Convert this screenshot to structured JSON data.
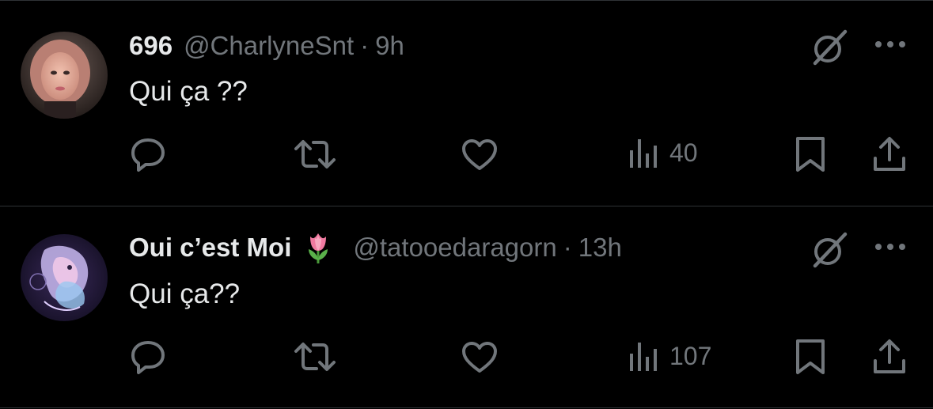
{
  "colors": {
    "background": "#000000",
    "primary_text": "#e7e9ea",
    "secondary_text": "#71767b",
    "divider": "#2f3336"
  },
  "tweets": [
    {
      "display_name": "696",
      "handle": "@CharlyneSnt",
      "separator": "·",
      "time": "9h",
      "text": "Qui ça ??",
      "views": "40",
      "avatar_icon": "photo-avatar",
      "name_emoji": ""
    },
    {
      "display_name": "Oui c’est Moi",
      "handle": "@tatooedaragorn",
      "separator": "·",
      "time": "13h",
      "text": "Qui ça??",
      "views": "107",
      "avatar_icon": "artwork-avatar",
      "name_emoji": "tulip-emoji"
    }
  ],
  "icons": {
    "reply": "reply-icon",
    "retweet": "retweet-icon",
    "like": "like-icon",
    "views": "views-icon",
    "bookmark": "bookmark-icon",
    "share": "share-icon",
    "grok": "grok-icon",
    "more": "more-icon"
  }
}
